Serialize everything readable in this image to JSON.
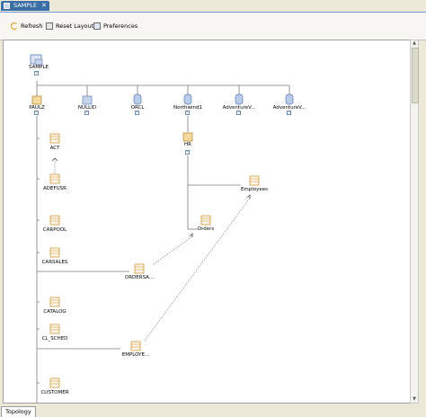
{
  "tab": {
    "title": "SAMPLE",
    "close": "✕"
  },
  "toolbar": {
    "refresh": "Refresh",
    "reset_layout": "Reset Layout",
    "preferences": "Preferences"
  },
  "bottom_tab": {
    "label": "Topology"
  },
  "nodes": {
    "sample": "SAMPLE",
    "paulz": "PAULZ",
    "nullid": "NULLID",
    "orcl": "ORCL",
    "northwind": "Northwind1",
    "adventure1": "AdventureV...",
    "adventure2": "AdventureV...",
    "act": "ACT",
    "adefusr": "ADEFUSR",
    "carpool": "CARPOOL",
    "carsales": "CARSALES",
    "catalog": "CATALOG",
    "cl_sched": "CL_SCHED",
    "customer": "CUSTOMER",
    "hr": "HR",
    "employees": "Employees",
    "orders": "Orders",
    "ordersa": "ORDERSA...",
    "employe": "EMPLOYE..."
  },
  "colors": {
    "tab_active": "#3a6ea5",
    "line": "#7a7a7a",
    "table_icon": "#e8a030",
    "schema_icon": "#5f7fb8"
  }
}
